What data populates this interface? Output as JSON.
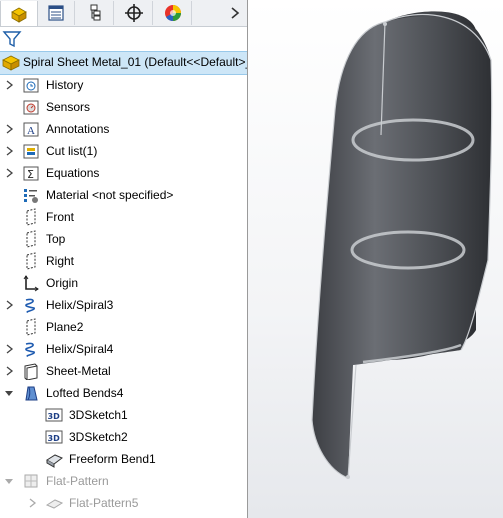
{
  "tabs": [
    {
      "name": "FeatureManager design tree",
      "icon": "feature-manager-icon",
      "active": true
    },
    {
      "name": "PropertyManager",
      "icon": "property-manager-icon",
      "active": false
    },
    {
      "name": "ConfigurationManager",
      "icon": "configuration-manager-icon",
      "active": false
    },
    {
      "name": "DimXpertManager",
      "icon": "dimxpert-icon",
      "active": false
    },
    {
      "name": "DisplayManager",
      "icon": "display-manager-icon",
      "active": false
    }
  ],
  "tabs_more_icon": "chevron-right-icon",
  "filter_icon": "filter-icon",
  "root": {
    "label": "Spiral Sheet Metal_01  (Default<<Default>_",
    "icon": "part-icon"
  },
  "tree": [
    {
      "label": "History",
      "icon": "history-icon",
      "expandable": true
    },
    {
      "label": "Sensors",
      "icon": "sensors-icon",
      "expandable": false
    },
    {
      "label": "Annotations",
      "icon": "annotations-icon",
      "expandable": true
    },
    {
      "label": "Cut list(1)",
      "icon": "cut-list-icon",
      "expandable": true
    },
    {
      "label": "Equations",
      "icon": "equations-icon",
      "expandable": true
    },
    {
      "label": "Material <not specified>",
      "icon": "material-icon",
      "expandable": false
    },
    {
      "label": "Front",
      "icon": "plane-icon",
      "expandable": false
    },
    {
      "label": "Top",
      "icon": "plane-icon",
      "expandable": false
    },
    {
      "label": "Right",
      "icon": "plane-icon",
      "expandable": false
    },
    {
      "label": "Origin",
      "icon": "origin-icon",
      "expandable": false
    },
    {
      "label": "Helix/Spiral3",
      "icon": "helix-icon",
      "expandable": true
    },
    {
      "label": "Plane2",
      "icon": "plane-icon",
      "expandable": false
    },
    {
      "label": "Helix/Spiral4",
      "icon": "helix-icon",
      "expandable": true
    },
    {
      "label": "Sheet-Metal",
      "icon": "sheet-metal-icon",
      "expandable": true
    },
    {
      "label": "Lofted Bends4",
      "icon": "lofted-bends-icon",
      "expandable": true,
      "expanded": true
    },
    {
      "label": "3DSketch1",
      "icon": "3d-sketch-icon",
      "expandable": false,
      "indent": 1
    },
    {
      "label": "3DSketch2",
      "icon": "3d-sketch-icon",
      "expandable": false,
      "indent": 1
    },
    {
      "label": "Freeform Bend1",
      "icon": "freeform-bend-icon",
      "expandable": false,
      "indent": 1
    },
    {
      "label": "Flat-Pattern",
      "icon": "flat-pattern-icon",
      "expandable": true,
      "expanded": true,
      "disabled": true
    },
    {
      "label": "Flat-Pattern5",
      "icon": "flat-pattern-feature-icon",
      "expandable": true,
      "disabled": true,
      "indent": 1
    }
  ],
  "viewport": {
    "model": "spiral-sheet-metal-model",
    "body_color": "#5a5d63",
    "edge_color": "#c9ccd0"
  }
}
